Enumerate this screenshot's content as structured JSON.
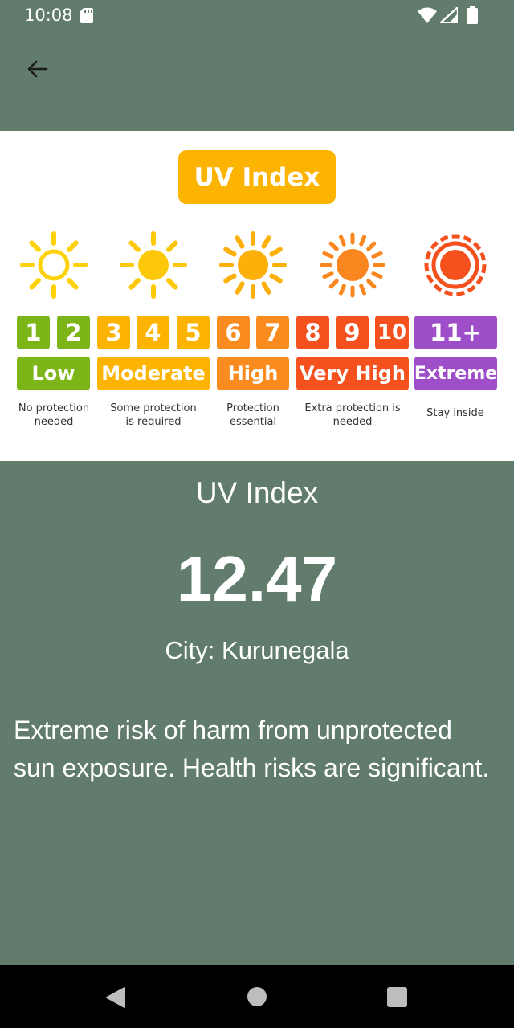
{
  "status_bar": {
    "time": "10:08"
  },
  "chart": {
    "title": "UV Index",
    "numbers": [
      {
        "text": "1",
        "color": "#7cb518"
      },
      {
        "text": "2",
        "color": "#7cb518"
      },
      {
        "text": "3",
        "color": "#fdb400"
      },
      {
        "text": "4",
        "color": "#fdb400"
      },
      {
        "text": "5",
        "color": "#fdb400"
      },
      {
        "text": "6",
        "color": "#f98b1f"
      },
      {
        "text": "7",
        "color": "#f98b1f"
      },
      {
        "text": "8",
        "color": "#f4511e"
      },
      {
        "text": "9",
        "color": "#f4511e"
      },
      {
        "text": "10",
        "color": "#f4511e"
      },
      {
        "text": "11+",
        "color": "#9e4ec8"
      }
    ],
    "levels": [
      {
        "label": "Low",
        "desc": "No protection needed",
        "color": "#7cb518"
      },
      {
        "label": "Moderate",
        "desc": "Some protection is required",
        "color": "#fdb400"
      },
      {
        "label": "High",
        "desc": "Protection essential",
        "color": "#f98b1f"
      },
      {
        "label": "Very High",
        "desc": "Extra protection is needed",
        "color": "#f4511e"
      },
      {
        "label": "Extreme",
        "desc": "Stay inside",
        "color": "#9e4ec8"
      }
    ],
    "sun_colors": [
      "#fdd20a",
      "#fdc80a",
      "#fdb00a",
      "#f9861f",
      "#f4511e"
    ]
  },
  "uv": {
    "label": "UV Index",
    "value": "12.47",
    "city": "City: Kurunegala",
    "description": "Extreme risk of harm from unprotected sun exposure. Health risks are significant."
  },
  "colors": {
    "background": "#617c6d",
    "panel": "#ffffff"
  },
  "icons": [
    "sd-card-icon",
    "wifi-icon",
    "signal-icon",
    "battery-icon",
    "back-arrow-icon",
    "nav-back-icon",
    "nav-home-icon",
    "nav-recents-icon"
  ]
}
